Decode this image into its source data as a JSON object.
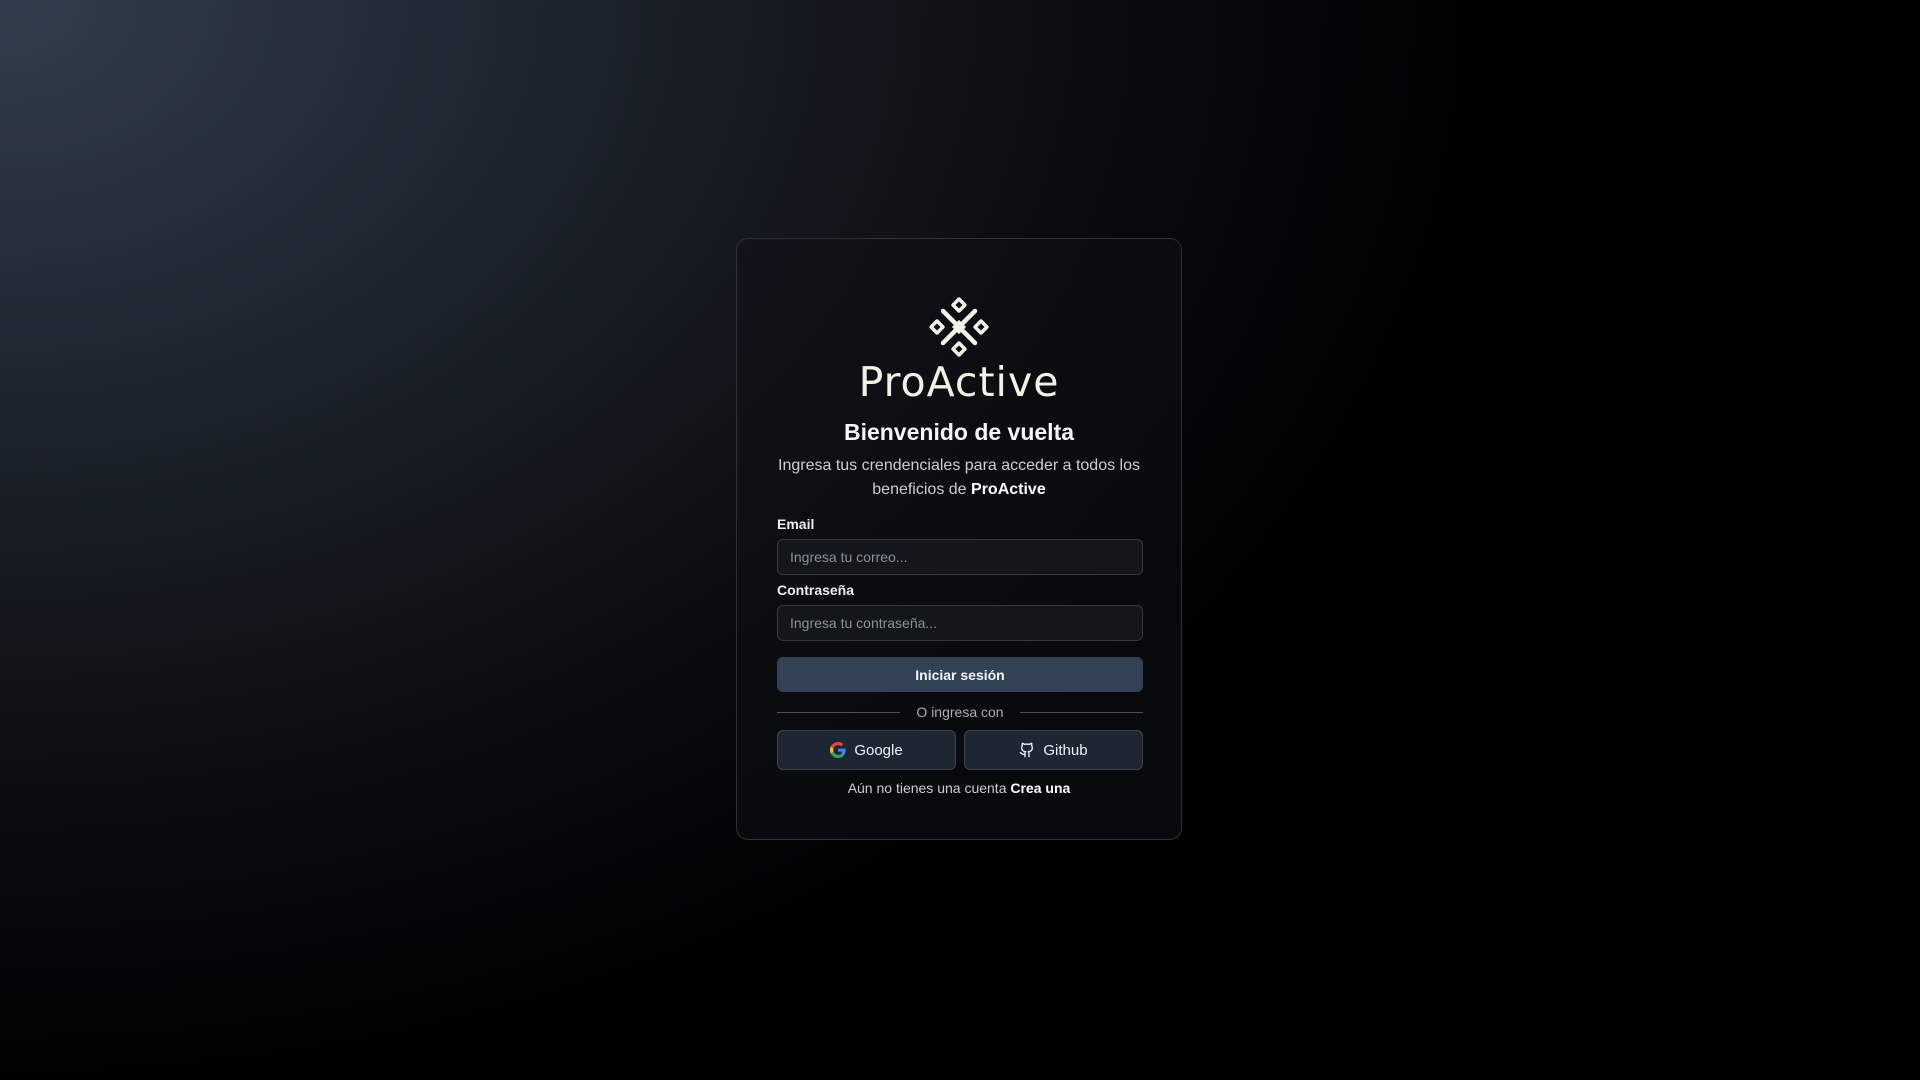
{
  "brand": {
    "logo_icon": "proactive-logo-icon",
    "name": "ProActive"
  },
  "login": {
    "title": "Bienvenido de vuelta",
    "subtitle_prefix": "Ingresa tus crendenciales para acceder a todos los beneficios de",
    "subtitle_brand": "ProActive",
    "email_label": "Email",
    "email_placeholder": "Ingresa tu correo...",
    "email_value": "",
    "password_label": "Contraseña",
    "password_placeholder": "Ingresa tu contraseña...",
    "password_value": "",
    "submit_label": "Iniciar sesión",
    "divider_text": "O ingresa con",
    "google_label": "Google",
    "google_icon": "google-icon",
    "github_label": "Github",
    "github_icon": "github-icon",
    "signup_prompt": "Aún no tienes una cuenta",
    "signup_link": "Crea una"
  },
  "colors": {
    "primary_button": "#334155",
    "social_button": "#1e2633",
    "logo": "#eef3e6"
  }
}
